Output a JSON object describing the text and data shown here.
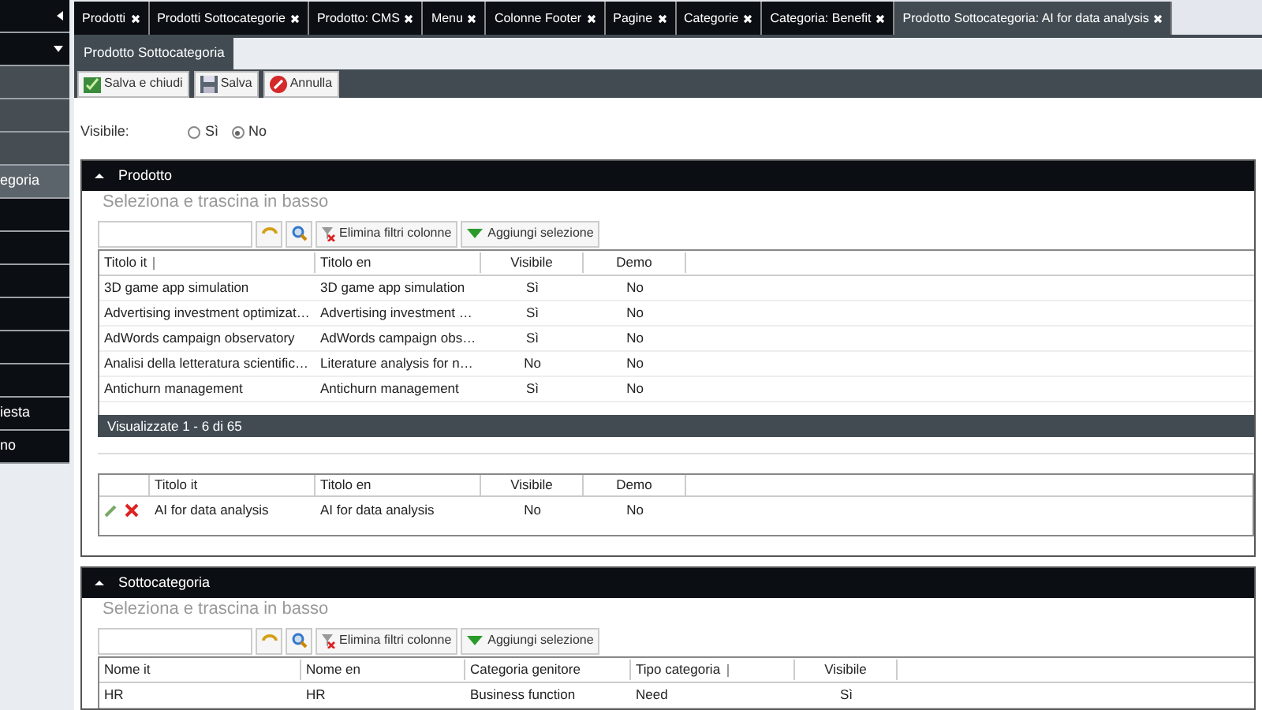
{
  "sidebar": {
    "items": [
      {
        "kind": "header",
        "selected": false
      },
      {
        "kind": "menu",
        "selected": false
      },
      {
        "kind": "group",
        "selected": false
      },
      {
        "kind": "group",
        "selected": false
      },
      {
        "kind": "group",
        "selected": false
      },
      {
        "kind": "item",
        "label": "egoria",
        "selected": true
      },
      {
        "kind": "item",
        "selected": false
      },
      {
        "kind": "item",
        "selected": false
      },
      {
        "kind": "item",
        "selected": false
      },
      {
        "kind": "item",
        "selected": false
      },
      {
        "kind": "item",
        "selected": false
      },
      {
        "kind": "item",
        "selected": false
      },
      {
        "kind": "item",
        "label": "iesta",
        "selected": false
      },
      {
        "kind": "item",
        "label": "no",
        "selected": false
      }
    ]
  },
  "tabs": [
    {
      "label": "Prodotti",
      "selected": false
    },
    {
      "label": "Prodotti Sottocategorie",
      "selected": false
    },
    {
      "label": "Prodotto: CMS",
      "selected": false
    },
    {
      "label": "Menu",
      "selected": false
    },
    {
      "label": "Colonne Footer",
      "selected": false
    },
    {
      "label": "Pagine",
      "selected": false
    },
    {
      "label": "Categorie",
      "selected": false
    },
    {
      "label": "Categoria: Benefit",
      "selected": false
    },
    {
      "label": "Prodotto Sottocategoria: AI for data analysis",
      "selected": true
    }
  ],
  "subtabs": [
    {
      "label": "Prodotto Sottocategoria",
      "selected": true
    }
  ],
  "toolbar": [
    {
      "kind": "save_close",
      "label": "Salva e chiudi"
    },
    {
      "kind": "save",
      "label": "Salva"
    },
    {
      "kind": "cancel",
      "label": "Annulla"
    }
  ],
  "visibile": {
    "label": "Visibile:",
    "options": [
      {
        "label": "Sì",
        "selected": false
      },
      {
        "label": "No",
        "selected": true
      }
    ]
  },
  "panels": [
    {
      "title": "Prodotto",
      "expanded": true,
      "hint": "Seleziona e trascina in basso",
      "clear_filters": "Elimina filtri colonne",
      "add_selection": "Aggiungi selezione",
      "columns": [
        {
          "label": "Titolo it",
          "sorted": true,
          "kind": "text"
        },
        {
          "label": "Titolo en",
          "sorted": false,
          "kind": "text"
        },
        {
          "label": "Visibile",
          "sorted": false,
          "kind": "flag"
        },
        {
          "label": "Demo",
          "sorted": false,
          "kind": "flag"
        }
      ],
      "rows": [
        [
          "3D game app simulation",
          "3D game app simulation",
          "Sì",
          "No"
        ],
        [
          "Advertising investment optimizat…",
          "Advertising investment …",
          "Sì",
          "No"
        ],
        [
          "AdWords campaign observatory",
          "AdWords campaign obs…",
          "Sì",
          "No"
        ],
        [
          "Analisi della letteratura scientific…",
          "Literature analysis for n…",
          "No",
          "No"
        ],
        [
          "Antichurn management",
          "Antichurn management",
          "Sì",
          "No"
        ]
      ],
      "pager": "Visualizzate 1 - 6 di 65",
      "selection": {
        "columns": [
          "Titolo it",
          "Titolo en",
          "Visibile",
          "Demo"
        ],
        "rows": [
          [
            "AI for data analysis",
            "AI for data analysis",
            "No",
            "No"
          ]
        ]
      }
    },
    {
      "title": "Sottocategoria",
      "expanded": true,
      "hint": "Seleziona e trascina in basso",
      "clear_filters": "Elimina filtri colonne",
      "add_selection": "Aggiungi selezione",
      "columns": [
        {
          "label": "Nome it",
          "sorted": false,
          "kind": "text"
        },
        {
          "label": "Nome en",
          "sorted": false,
          "kind": "text"
        },
        {
          "label": "Categoria genitore",
          "sorted": false,
          "kind": "text"
        },
        {
          "label": "Tipo categoria",
          "sorted": true,
          "kind": "text"
        },
        {
          "label": "Visibile",
          "sorted": false,
          "kind": "flag"
        }
      ],
      "rows": [
        [
          "HR",
          "HR",
          "Business function",
          "Need",
          "Sì"
        ]
      ]
    }
  ]
}
